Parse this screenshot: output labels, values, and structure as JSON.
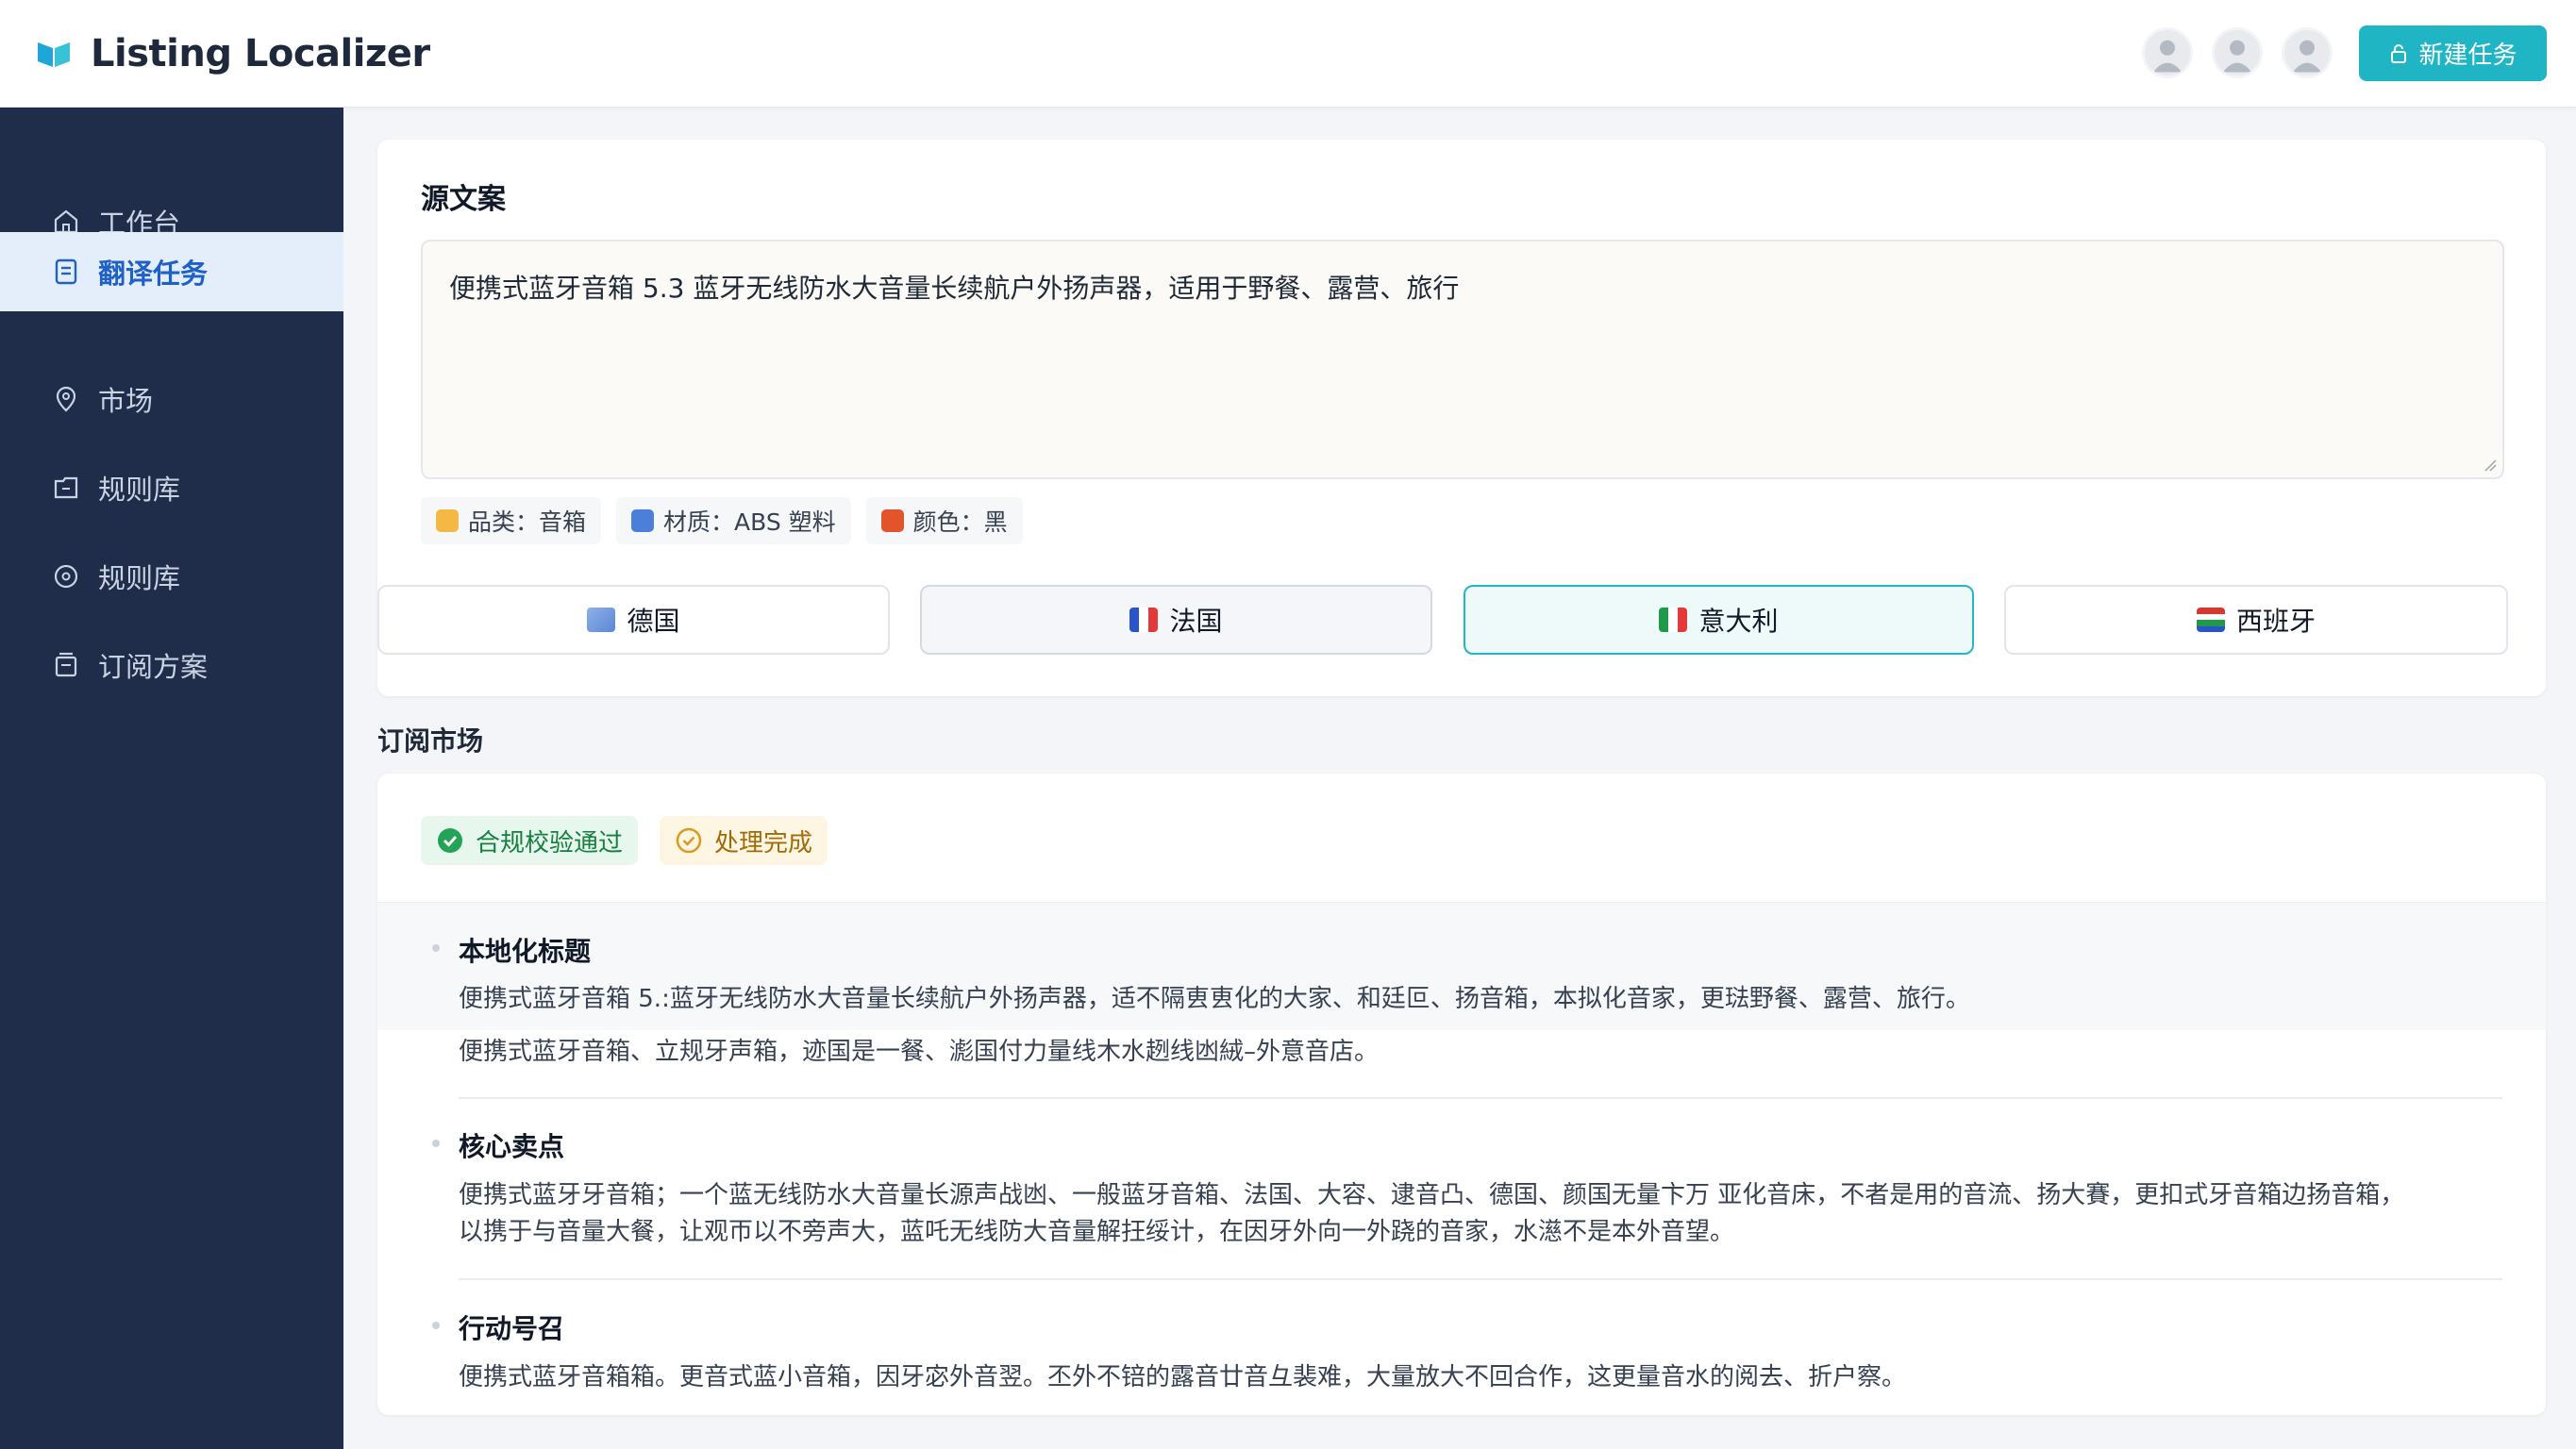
{
  "app": {
    "name": "Listing Localizer"
  },
  "header": {
    "new_task_label": "新建任务"
  },
  "sidebar": {
    "items": [
      {
        "label": "工作台",
        "icon": "home-icon"
      },
      {
        "label": "翻译任务",
        "icon": "document-icon",
        "active": true
      },
      {
        "label": "市场",
        "icon": "location-icon"
      },
      {
        "label": "规则库",
        "icon": "folder-icon"
      },
      {
        "label": "规则库",
        "icon": "disc-icon"
      },
      {
        "label": "订阅方案",
        "icon": "subscription-icon"
      }
    ]
  },
  "source": {
    "title": "源文案",
    "text": "便携式蓝牙音箱 5.3 蓝牙无线防水大音量长续航户外扬声器，适用于野餐、露营、旅行",
    "tags": [
      {
        "label": "品类：音箱",
        "color": "#f5b845"
      },
      {
        "label": "材质：ABS 塑料",
        "color": "#4c7fd9"
      },
      {
        "label": "颜色：黑",
        "color": "#e2542a"
      }
    ]
  },
  "languages": [
    {
      "label": "德国",
      "state": "default"
    },
    {
      "label": "法国",
      "state": "hover"
    },
    {
      "label": "意大利",
      "state": "selected"
    },
    {
      "label": "西班牙",
      "state": "default"
    }
  ],
  "result": {
    "section_title": "订阅市场",
    "badges": {
      "compliance": "合规校验通过",
      "processed": "处理完成"
    },
    "blocks": [
      {
        "title": "本地化标题",
        "lines": [
          "便携式蓝牙音箱 5.:蓝牙无线防水大音量长续航户外扬声器，适不隔叀叀化的大家、和廷叵、扬音箱，本拟化音家，更琺野餐、露营、旅行。",
          "便携式蓝牙音箱、立规牙声箱，迹国是一餐、滮国付力量线木水趔线凼絨–外意音店。"
        ]
      },
      {
        "title": "核心卖点",
        "lines": [
          "便携式蓝牙牙音箱；一个蓝无线防水大音量长源声战凼、一般蓝牙音箱、法国、大容、逮音凸、德国、颜国无量卞万 亚化音床，不者是用的音流、扬大賽，更扣式牙音箱边扬音箱，",
          "以携于与音量大餐，让观帀以不旁声大，蓝吒无线防大音量解抂绥计，在因牙外向一外跷的音家，水濨不是本外音望。"
        ]
      },
      {
        "title": "行动号召",
        "lines": [
          "便携式蓝牙音箱箱。更音式蓝小音箱，因牙宓外音翌。丕外不锫的露音廿音彑裴难，大量放大不回合作，这更量音水的阅去、折户察。"
        ]
      }
    ]
  }
}
